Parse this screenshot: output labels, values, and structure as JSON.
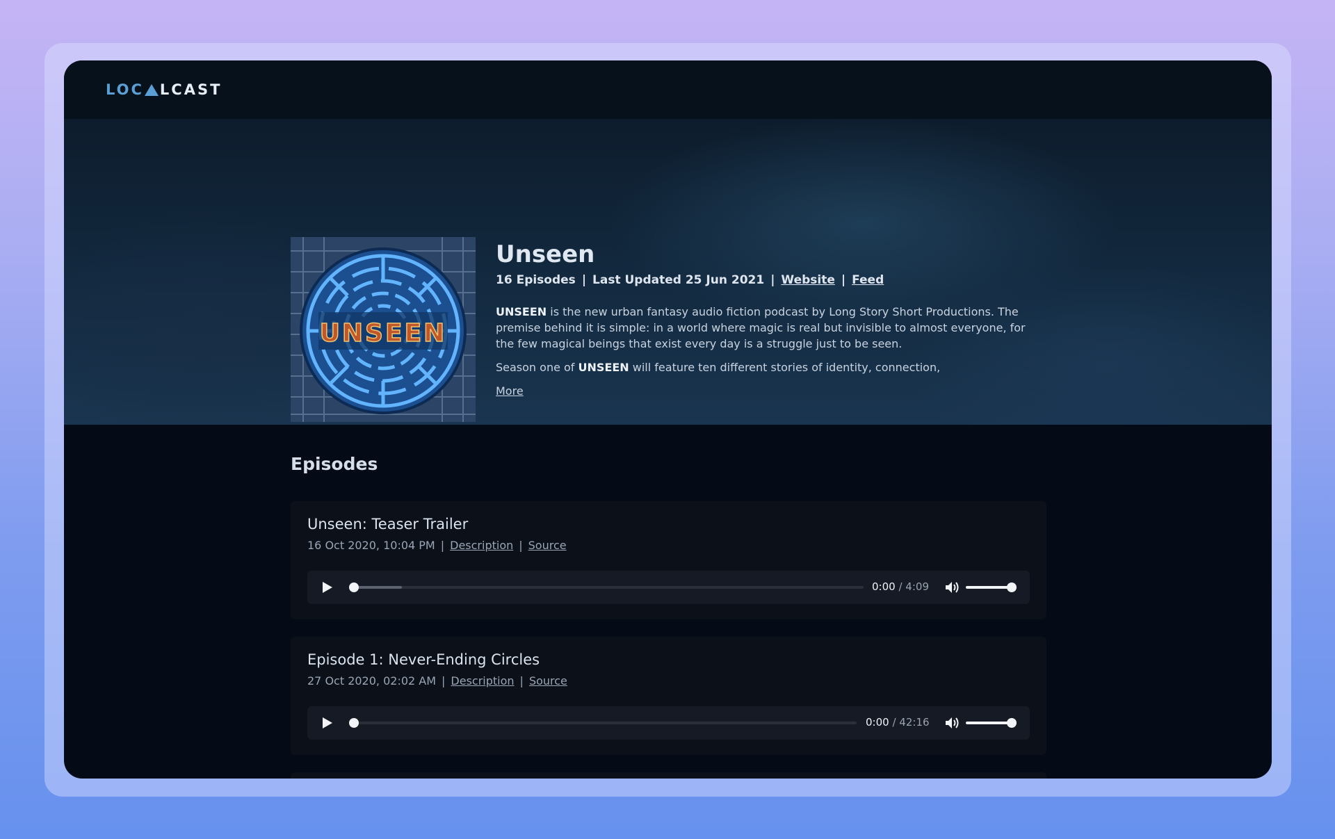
{
  "app": {
    "logo_prefix": "LOC",
    "logo_suffix": "LCAST",
    "brand_color": "#5aa0d6"
  },
  "podcast": {
    "title": "Unseen",
    "cover_text": "UNSEEN",
    "episode_count": "16 Episodes",
    "last_updated": "Last Updated 25 Jun 2021",
    "website_label": "Website",
    "feed_label": "Feed",
    "separator": "|",
    "desc_p1_bold": "UNSEEN",
    "desc_p1_rest": " is the new urban fantasy audio fiction podcast by Long Story Short Productions. The premise behind it is simple: in a world where magic is real but invisible to almost everyone, for the few magical beings that exist every day is a struggle just to be seen.",
    "desc_p2_pre": "Season one of ",
    "desc_p2_bold": "UNSEEN",
    "desc_p2_rest": " will feature ten different stories of identity, connection,",
    "more_label": "More"
  },
  "episodes_section": {
    "heading": "Episodes",
    "items": [
      {
        "title": "Unseen: Teaser Trailer",
        "date": "16 Oct 2020, 10:04 PM",
        "description_label": "Description",
        "source_label": "Source",
        "current_time": "0:00",
        "duration": "4:09",
        "buffered_fraction": 0.1,
        "volume_fraction": 1.0
      },
      {
        "title": "Episode 1: Never-Ending Circles",
        "date": "27 Oct 2020, 02:02 AM",
        "description_label": "Description",
        "source_label": "Source",
        "current_time": "0:00",
        "duration": "42:16",
        "buffered_fraction": 0.0,
        "volume_fraction": 1.0
      }
    ]
  }
}
